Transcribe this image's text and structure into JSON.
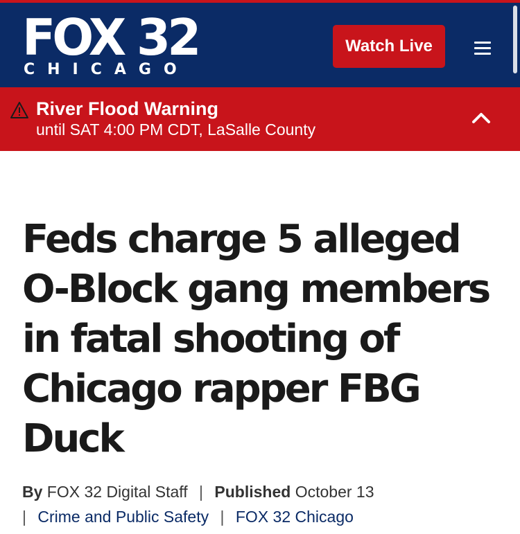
{
  "header": {
    "logo_main": "FOX 32",
    "logo_sub": "CHICAGO",
    "watch_live_label": "Watch Live",
    "menu_icon": "hamburger-menu-icon",
    "brand_color": "#0b2b66",
    "accent_color": "#c8141b"
  },
  "alert": {
    "icon": "warning-triangle-icon",
    "title": "River Flood Warning",
    "detail": "until SAT 4:00 PM CDT, LaSalle County",
    "chevron_icon": "chevron-up-icon"
  },
  "article": {
    "headline": "Feds charge 5 alleged O-Block gang members in fatal shooting of Chicago rapper FBG Duck",
    "by_label": "By",
    "author": "FOX 32 Digital Staff",
    "published_label": "Published",
    "published_date": "October 13",
    "category_link": "Crime and Public Safety",
    "source_link": "FOX 32 Chicago"
  }
}
